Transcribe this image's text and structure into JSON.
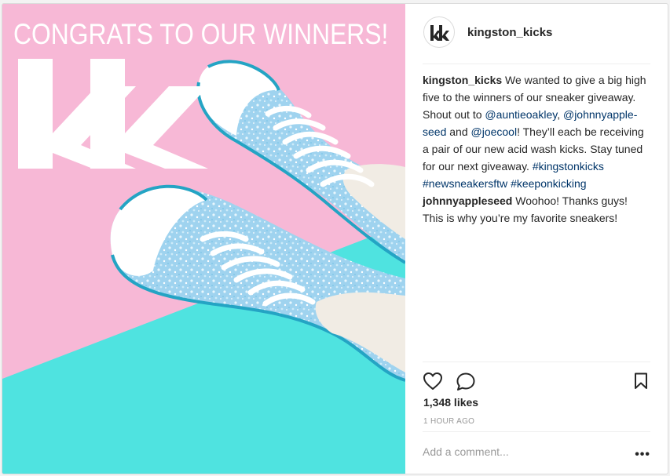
{
  "post": {
    "image_headline": "CONGRATS TO OUR WINNERS!",
    "brand_logo_alt": "kk",
    "author": {
      "username": "kingston_kicks"
    },
    "caption": {
      "author": "kingston_kicks",
      "text_1": " We wanted to give a big high five to the winners of our sneaker giveaway. Shout out to ",
      "mention_1": "@auntieoakley",
      "sep_1": ", ",
      "mention_2": "@johnnyapple-seed",
      "sep_2": " and ",
      "mention_3": "@joecool",
      "text_2": "! They’ll each be receiving a pair of our new acid wash kicks. Stay tuned for our next giveaway. ",
      "hashtag_1": "#kingstonkicks",
      "hashtag_2": "#newsneakersftw",
      "hashtag_3": "#keeponkicking"
    },
    "comment": {
      "username": "johnnyappleseed",
      "text": " Woohoo! Thanks guys! This is why you’re my favorite sneakers!"
    },
    "likes": "1,348 likes",
    "time_ago": "1 HOUR AGO",
    "add_comment_placeholder": "Add a comment...",
    "more_label": "•••"
  },
  "icons": {
    "like": "heart-icon",
    "comment": "speech-bubble-icon",
    "save": "bookmark-icon"
  },
  "colors": {
    "link": "#003569",
    "pink_bg": "#f7b8d6",
    "teal_bg": "#4fe3e0"
  }
}
